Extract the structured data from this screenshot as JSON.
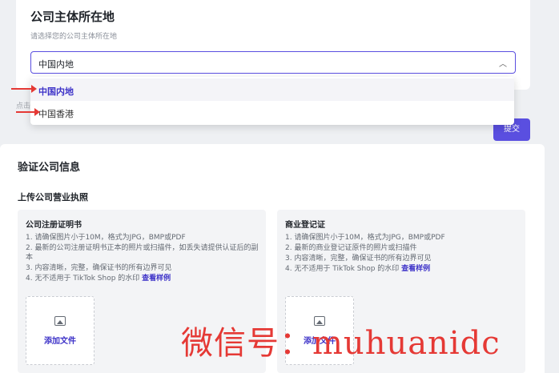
{
  "location": {
    "title": "公司主体所在地",
    "subtitle": "请选择您的公司主体所在地",
    "selected_value": "中国内地",
    "options": [
      "中国内地",
      "中国香港"
    ],
    "hint_partial": "点击",
    "submit_label": "提交"
  },
  "verify": {
    "title": "验证公司信息",
    "subtitle": "上传公司营业执照",
    "docs": [
      {
        "title": "公司注册证明书",
        "reqs": [
          "1. 请确保图片小于10M，格式为JPG，BMP或PDF",
          "2. 最新的公司注册证明书正本的照片或扫描件，如丢失请提供认证后的副本",
          "3. 内容清晰，完整，确保证书的所有边界可见",
          "4. 无不适用于 TikTok Shop 的水印"
        ],
        "sample_link": "查看样例",
        "upload_label": "添加文件"
      },
      {
        "title": "商业登记证",
        "reqs": [
          "1. 请确保图片小于10M，格式为JPG，BMP或PDF",
          "2. 最新的商业登记证原件的照片或扫描件",
          "3. 内容清晰，完整，确保证书的所有边界可见",
          "4. 无不适用于 TikTok Shop 的水印"
        ],
        "sample_link": "查看样例",
        "upload_label": "添加文件"
      }
    ]
  },
  "watermark": "微信号：muhuanidc",
  "colors": {
    "accent": "#5a4fe0",
    "annotation": "#e53935"
  }
}
